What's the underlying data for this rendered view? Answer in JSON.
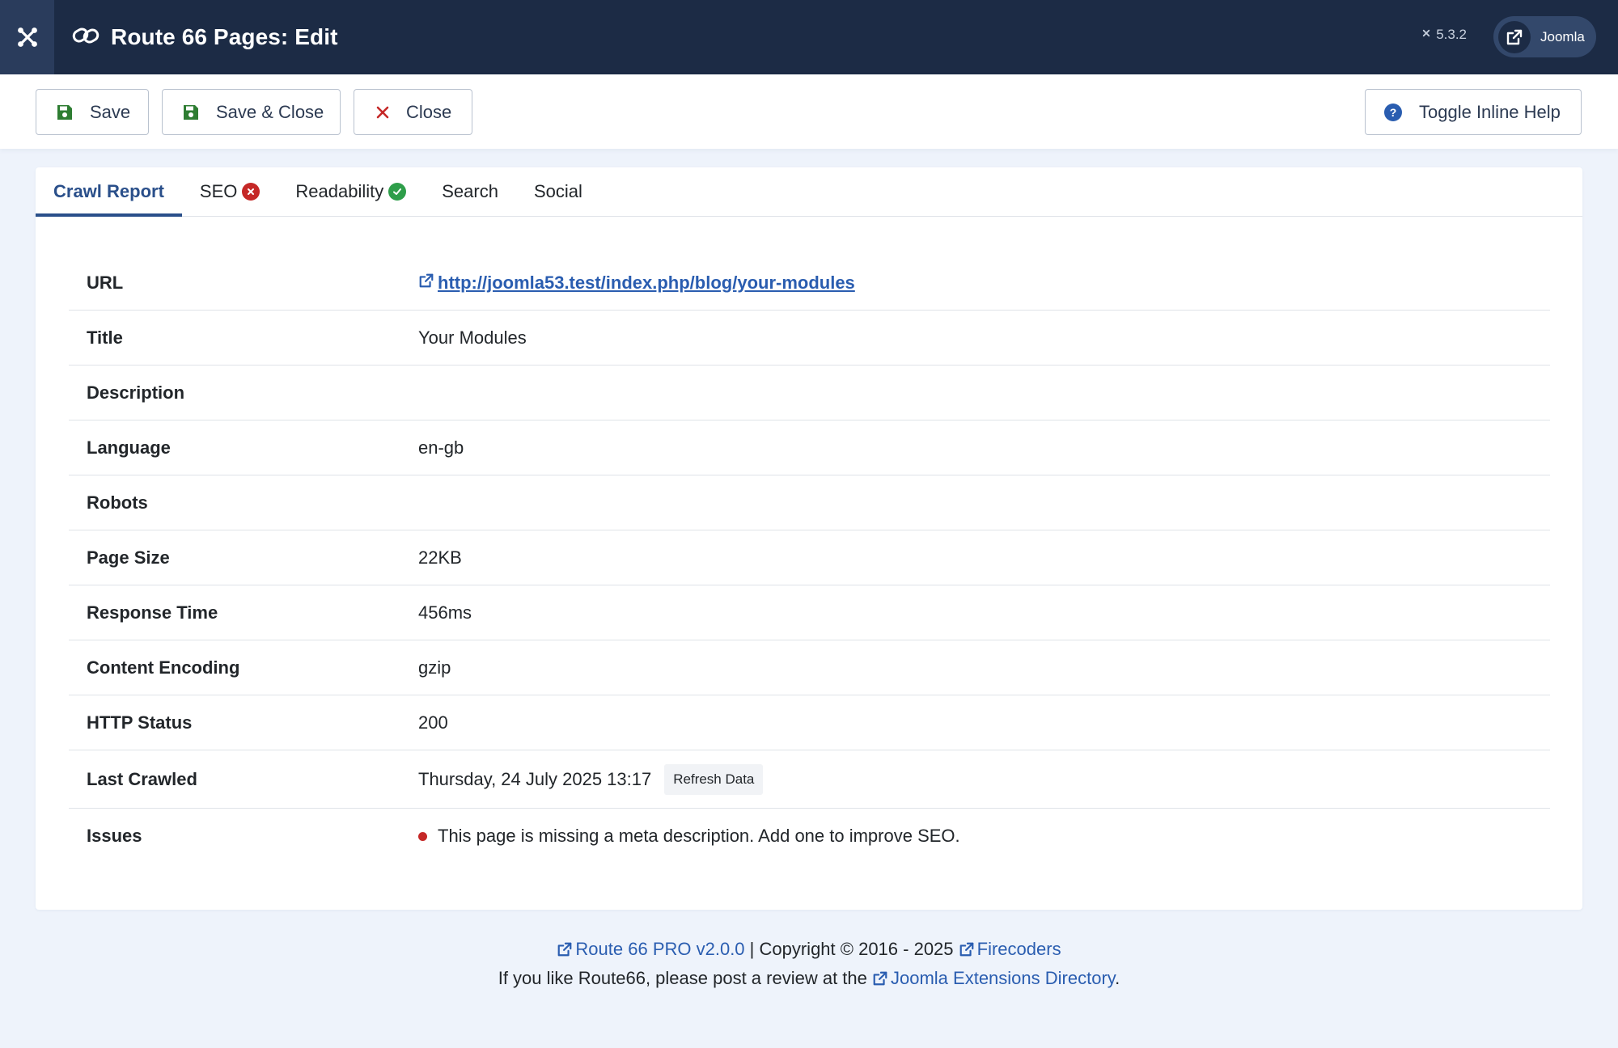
{
  "header": {
    "title": "Route 66 Pages: Edit",
    "version": "5.3.2",
    "site_label": "Joomla"
  },
  "toolbar": {
    "save_label": "Save",
    "save_close_label": "Save & Close",
    "close_label": "Close",
    "help_label": "Toggle Inline Help"
  },
  "tabs": [
    {
      "label": "Crawl Report",
      "active": true
    },
    {
      "label": "SEO",
      "status": "error"
    },
    {
      "label": "Readability",
      "status": "ok"
    },
    {
      "label": "Search"
    },
    {
      "label": "Social"
    }
  ],
  "report": {
    "url": {
      "label": "URL",
      "value": "http://joomla53.test/index.php/blog/your-modules"
    },
    "title": {
      "label": "Title",
      "value": "Your Modules"
    },
    "description": {
      "label": "Description",
      "value": ""
    },
    "language": {
      "label": "Language",
      "value": "en-gb"
    },
    "robots": {
      "label": "Robots",
      "value": ""
    },
    "page_size": {
      "label": "Page Size",
      "value": "22KB"
    },
    "response_time": {
      "label": "Response Time",
      "value": "456ms"
    },
    "content_encoding": {
      "label": "Content Encoding",
      "value": "gzip"
    },
    "http_status": {
      "label": "HTTP Status",
      "value": "200"
    },
    "last_crawled": {
      "label": "Last Crawled",
      "value": "Thursday, 24 July 2025 13:17",
      "refresh_label": "Refresh Data"
    },
    "issues": {
      "label": "Issues",
      "items": [
        "This page is missing a meta description. Add one to improve SEO."
      ]
    }
  },
  "footer": {
    "product_link": "Route 66 PRO v2.0.0",
    "copyright": "| Copyright © 2016 - 2025",
    "vendor_link": "Firecoders",
    "review_prefix": "If you like Route66, please post a review at the",
    "review_link": "Joomla Extensions Directory",
    "review_suffix": "."
  },
  "colors": {
    "header_bg": "#1c2b45",
    "accent": "#2a4f8a",
    "link": "#2a5db0",
    "error": "#c52827",
    "success": "#2e9e4a",
    "save_icon": "#2e7d32",
    "close_icon": "#c52827",
    "help_icon": "#2a5db0"
  },
  "icons": {
    "brand": "joomla-logo-icon",
    "title": "link-icon",
    "save": "floppy-disk-icon",
    "close": "x-icon",
    "help": "question-circle-icon",
    "external": "external-link-icon"
  }
}
